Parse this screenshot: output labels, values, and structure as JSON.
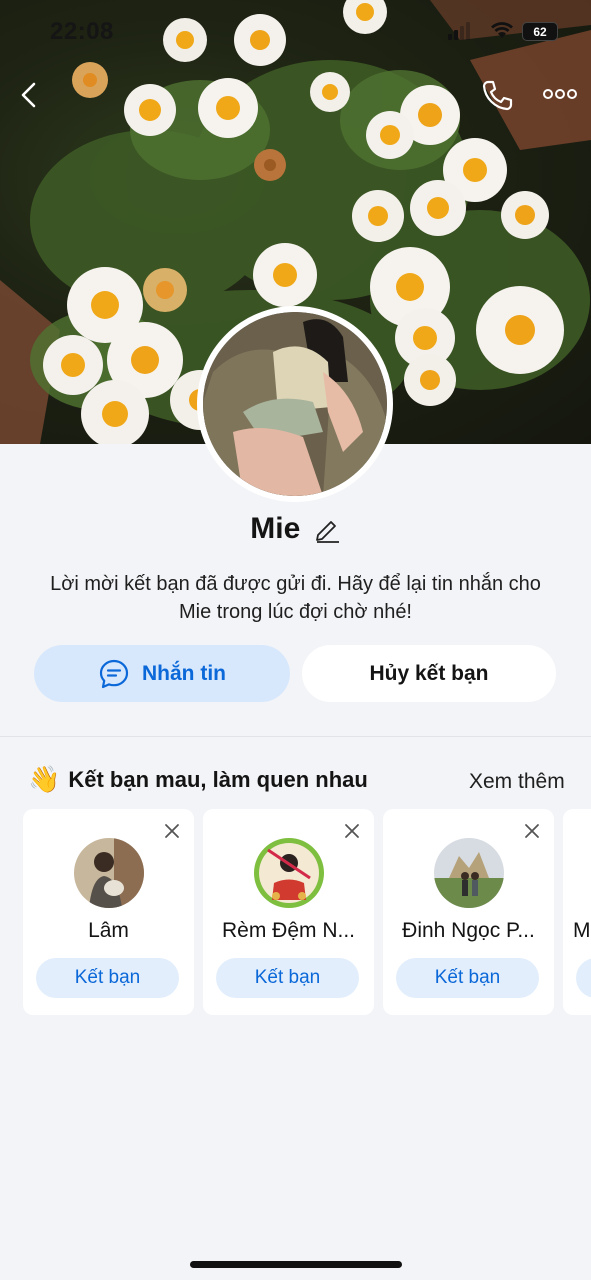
{
  "status_bar": {
    "time": "22:08",
    "battery": "62"
  },
  "profile": {
    "name": "Mie",
    "message": "Lời mời kết bạn đã được gửi đi. Hãy để lại tin nhắn cho Mie trong lúc đợi chờ nhé!"
  },
  "actions": {
    "message_label": "Nhắn tin",
    "unfriend_label": "Hủy kết bạn"
  },
  "suggestions": {
    "title": "Kết bạn mau, làm quen nhau",
    "title_emoji": "👋",
    "see_more": "Xem thêm",
    "cards": [
      {
        "name": "Lâm",
        "button": "Kết bạn"
      },
      {
        "name": "Rèm Đệm N...",
        "button": "Kết bạn"
      },
      {
        "name": "Đinh Ngọc P...",
        "button": "Kết bạn"
      },
      {
        "name": "M",
        "button": ""
      }
    ]
  },
  "colors": {
    "accent": "#0b68d8",
    "accent_bg": "#d8e8fc",
    "page_bg": "#f3f4f7"
  }
}
